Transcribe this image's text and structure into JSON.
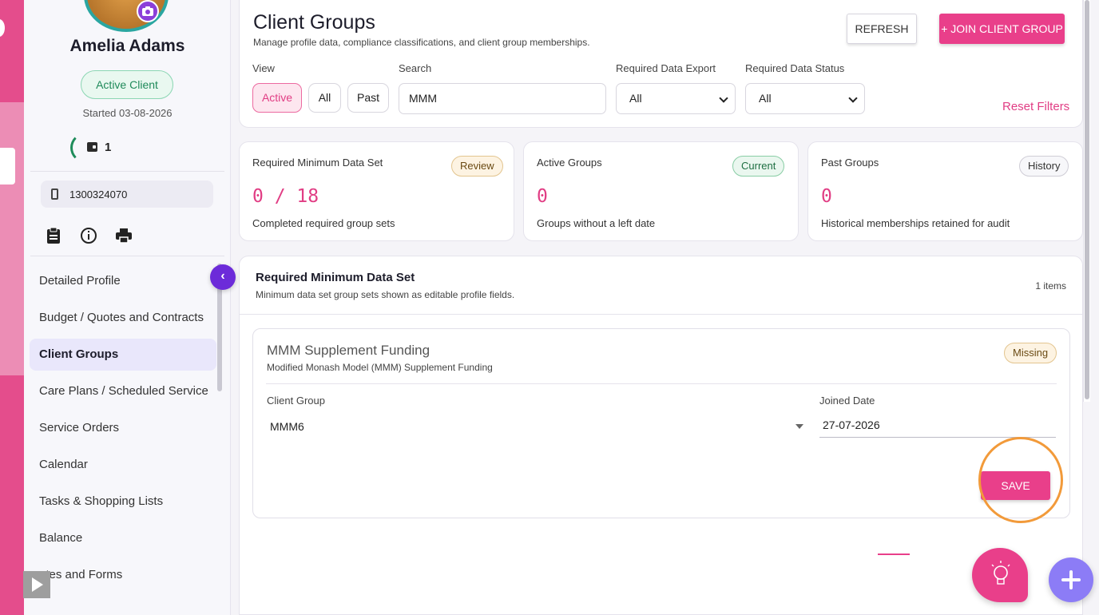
{
  "sidebar": {
    "user_name": "Amelia Adams",
    "status": "Active Client",
    "started": "Started 03-08-2026",
    "wallet_count": "1",
    "phone": "1300324070",
    "nav": [
      {
        "label": "Detailed Profile"
      },
      {
        "label": "Budget / Quotes and Contracts"
      },
      {
        "label": "Client Groups",
        "active": true
      },
      {
        "label": "Care Plans / Scheduled Service"
      },
      {
        "label": "Service Orders"
      },
      {
        "label": "Calendar"
      },
      {
        "label": "Tasks & Shopping Lists"
      },
      {
        "label": "Balance"
      },
      {
        "label": "otes and Forms"
      }
    ],
    "icons": [
      "camera-icon",
      "wallet-icon",
      "phone-icon",
      "clipboard-icon",
      "info-icon",
      "print-icon",
      "chevron-left-icon",
      "play-icon"
    ]
  },
  "header": {
    "title": "Client Groups",
    "subtitle": "Manage profile data, compliance classifications, and client group memberships.",
    "refresh_label": "REFRESH",
    "join_label": "+ JOIN CLIENT GROUP"
  },
  "filters": {
    "view_label": "View",
    "view_options": [
      "Active",
      "All",
      "Past"
    ],
    "view_selected": "Active",
    "search_label": "Search",
    "search_value": "MMM",
    "export_label": "Required Data Export",
    "export_value": "All",
    "status_label": "Required Data Status",
    "status_value": "All",
    "reset_label": "Reset Filters"
  },
  "stats": [
    {
      "title": "Required Minimum Data Set",
      "badge": "Review",
      "value": "0 / 18",
      "desc": "Completed required group sets"
    },
    {
      "title": "Active Groups",
      "badge": "Current",
      "value": "0",
      "desc": "Groups without a left date"
    },
    {
      "title": "Past Groups",
      "badge": "History",
      "value": "0",
      "desc": "Historical memberships retained for audit"
    }
  ],
  "section": {
    "title": "Required Minimum Data Set",
    "subtitle": "Minimum data set group sets shown as editable profile fields.",
    "count": "1 items",
    "item": {
      "title": "MMM Supplement Funding",
      "subtitle": "Modified Monash Model (MMM) Supplement Funding",
      "badge": "Missing",
      "group_label": "Client Group",
      "group_value": "MMM6",
      "date_label": "Joined Date",
      "date_value": "27-07-2026",
      "save_label": "SAVE"
    }
  },
  "colors": {
    "accent": "#e93f8a",
    "purple": "#6c2bd9",
    "fab_plus": "#8c7cf6",
    "highlight": "#f29a3a"
  }
}
